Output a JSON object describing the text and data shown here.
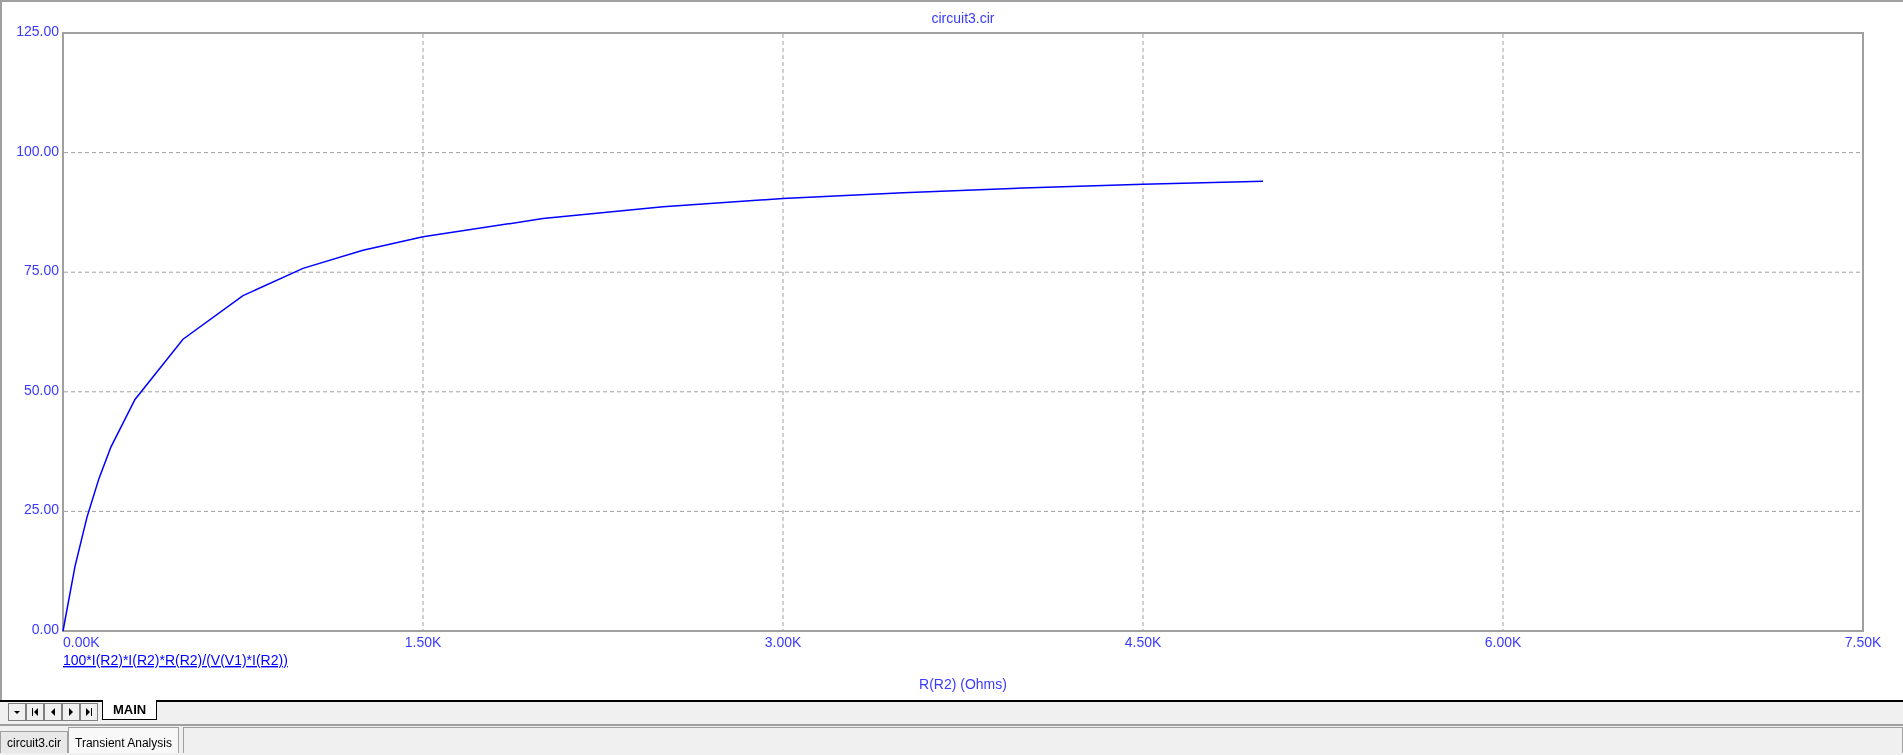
{
  "chart": {
    "chart_data": {
      "type": "line",
      "title": "circuit3.cir",
      "xlabel": "R(R2) (Ohms)",
      "x": [
        0,
        50,
        100,
        150,
        200,
        300,
        500,
        750,
        1000,
        1250,
        1500,
        2000,
        2500,
        3000,
        3500,
        4000,
        4500,
        5000
      ],
      "series": [
        {
          "name": "100*I(R2)*I(R2)*R(R2)/(V(V1)*I(R2))",
          "color": "#0000ff",
          "values": [
            0,
            13.5,
            23.8,
            31.9,
            38.5,
            48.4,
            61.0,
            70.1,
            75.8,
            79.6,
            82.4,
            86.2,
            88.7,
            90.4,
            91.6,
            92.6,
            93.4,
            94.0
          ]
        }
      ],
      "grid": true,
      "xlim": [
        0,
        7500
      ],
      "ylim": [
        0,
        125
      ],
      "xticks": [
        {
          "value": 0,
          "label": "0.00K"
        },
        {
          "value": 1500,
          "label": "1.50K"
        },
        {
          "value": 3000,
          "label": "3.00K"
        },
        {
          "value": 4500,
          "label": "4.50K"
        },
        {
          "value": 6000,
          "label": "6.00K"
        },
        {
          "value": 7500,
          "label": "7.50K"
        }
      ],
      "yticks": [
        {
          "value": 0,
          "label": "0.00"
        },
        {
          "value": 25,
          "label": "25.00"
        },
        {
          "value": 50,
          "label": "50.00"
        },
        {
          "value": 75,
          "label": "75.00"
        },
        {
          "value": 100,
          "label": "100.00"
        },
        {
          "value": 125,
          "label": "125.00"
        }
      ]
    }
  },
  "sheet_tabs": [
    {
      "label": "MAIN",
      "selected": true
    }
  ],
  "document_tabs": [
    {
      "label": "circuit3.cir",
      "selected": false
    },
    {
      "label": "Transient Analysis",
      "selected": true
    }
  ]
}
